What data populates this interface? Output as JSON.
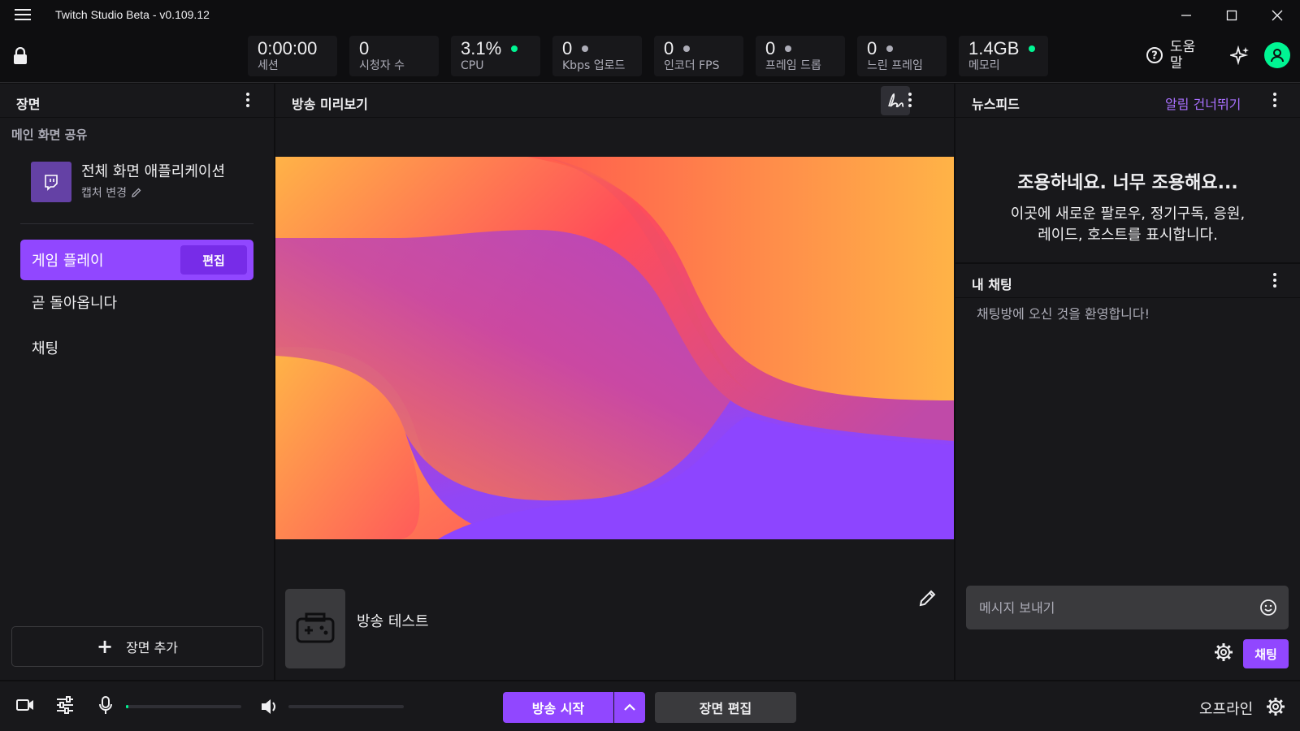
{
  "window": {
    "title": "Twitch Studio Beta - v0.109.12",
    "menu_icon": "hamburger-icon",
    "controls": [
      "minimize-icon",
      "maximize-icon",
      "close-icon"
    ]
  },
  "stats": {
    "session": {
      "value": "0:00:00",
      "label": "세션"
    },
    "viewers": {
      "value": "0",
      "label": "시청자 수"
    },
    "cpu": {
      "value": "3.1%",
      "label": "CPU",
      "dot_color": "#00f593"
    },
    "upload": {
      "value": "0",
      "label": "Kbps 업로드",
      "dot_color": "#adadb8"
    },
    "encoder_fps": {
      "value": "0",
      "label": "인코더 FPS",
      "dot_color": "#adadb8"
    },
    "dropped_frames": {
      "value": "0",
      "label": "프레임 드롭",
      "dot_color": "#adadb8"
    },
    "slow_frames": {
      "value": "0",
      "label": "느린 프레임",
      "dot_color": "#adadb8"
    },
    "memory": {
      "value": "1.4GB",
      "label": "메모리",
      "dot_color": "#00f593"
    }
  },
  "header_right": {
    "help_label": "도움말",
    "sparkle_icon": "sparkle-icon",
    "avatar_color": "#00f593"
  },
  "scenes": {
    "title": "장면",
    "section_title": "메인 화면 공유",
    "source": {
      "name": "전체 화면 애플리케이션",
      "sub": "캡처 변경"
    },
    "active_scene": {
      "label": "게임 플레이",
      "edit_label": "편집"
    },
    "items": [
      "곧 돌아옵니다",
      "채팅"
    ],
    "add_label": "장면 추가"
  },
  "preview": {
    "title": "방송 미리보기",
    "game_title": "방송 테스트"
  },
  "newsfeed": {
    "title": "뉴스피드",
    "skip_label": "알림 건너뛰기",
    "empty_title": "조용하네요. 너무 조용해요...",
    "empty_body": [
      "이곳에 새로운 팔로우, 정기구독, 응원,",
      "레이드, 호스트를 표시합니다."
    ]
  },
  "chat": {
    "title": "내 채팅",
    "welcome": "채팅방에 오신 것을 환영합니다!",
    "input_placeholder": "메시지 보내기",
    "send_label": "채팅"
  },
  "bottom": {
    "go_live_label": "방송 시작",
    "edit_scene_label": "장면 편집",
    "status_label": "오프라인"
  },
  "colors": {
    "accent": "#9147ff",
    "background": "#0e0e10",
    "panel": "#18181b",
    "online_green": "#00f593"
  }
}
